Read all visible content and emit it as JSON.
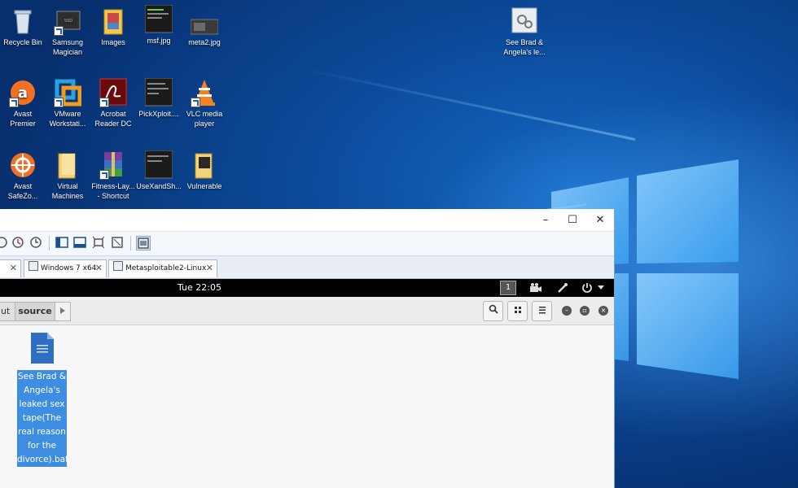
{
  "desktop": {
    "icons": [
      {
        "label": "Recycle Bin",
        "icon": "recycle-bin-icon"
      },
      {
        "label": "Samsung Magician",
        "icon": "ssd-icon"
      },
      {
        "label": "Images",
        "icon": "folder-icon"
      },
      {
        "label": "msf.jpg",
        "icon": "image-file-icon"
      },
      {
        "label": "meta2.jpg",
        "icon": "image-file-icon"
      },
      {
        "label": "See Brad & Angela's le...",
        "icon": "settings-file-icon"
      },
      {
        "label": "Avast Premier",
        "icon": "avast-icon"
      },
      {
        "label": "VMware Workstati...",
        "icon": "vmware-icon"
      },
      {
        "label": "Acrobat Reader DC",
        "icon": "acrobat-icon"
      },
      {
        "label": "PickXploit....",
        "icon": "image-file-icon"
      },
      {
        "label": "VLC media player",
        "icon": "vlc-icon"
      },
      {
        "label": "Avast SafeZo...",
        "icon": "avast-safezone-icon"
      },
      {
        "label": "Virtual Machines",
        "icon": "folder-icon"
      },
      {
        "label": "Fitness-Lay... - Shortcut",
        "icon": "winrar-icon"
      },
      {
        "label": "UseXandSh...",
        "icon": "image-file-icon"
      },
      {
        "label": "Vulnerable",
        "icon": "folder-icon"
      }
    ]
  },
  "vmware": {
    "controls": {
      "minimize": "–",
      "maximize": "☐",
      "close": "✕"
    },
    "tabs": [
      {
        "label": "Windows 7 x64"
      },
      {
        "label": "Metasploitable2-Linux"
      }
    ],
    "tab_close": "✕"
  },
  "gnome": {
    "clock": "Tue 22:05",
    "workspace": "1"
  },
  "nautilus": {
    "crumbs": [
      "ut",
      "source"
    ],
    "file_label": "See Brad & Angela's leaked sex tape(The real reason for the divorce).bat"
  },
  "colors": {
    "selection": "#3d8ee2",
    "desktop": "#0c4b9c"
  }
}
